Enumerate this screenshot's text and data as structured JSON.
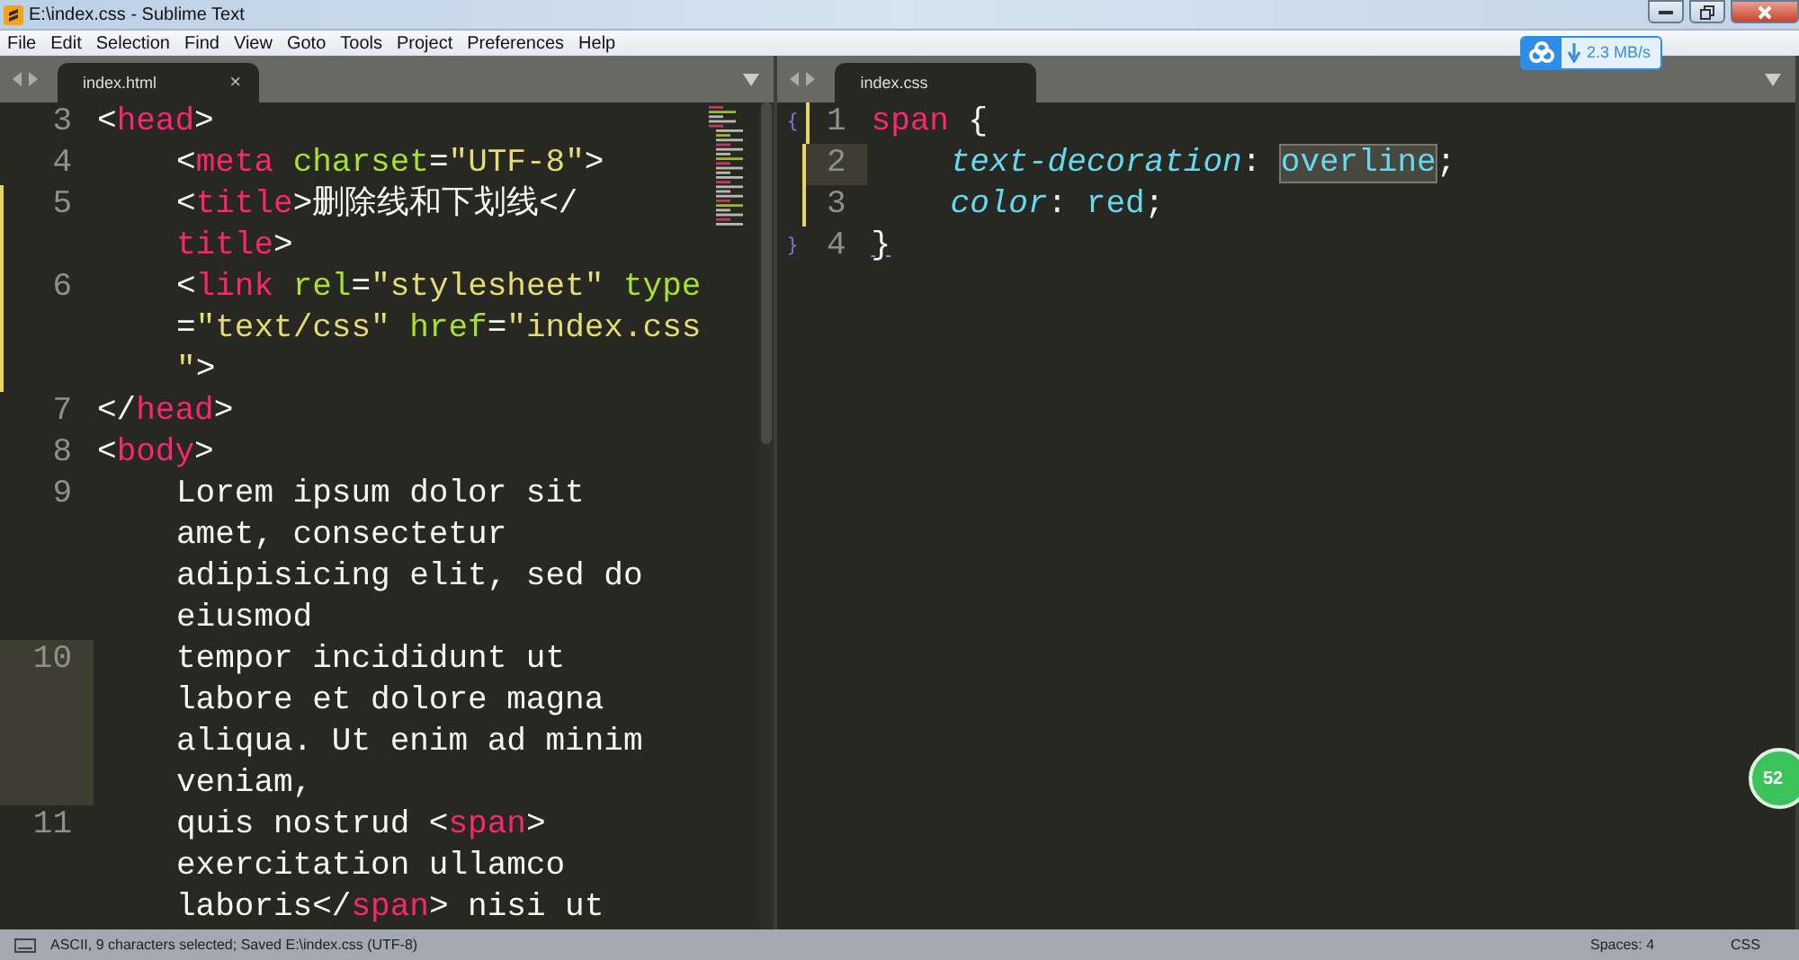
{
  "window": {
    "title": "E:\\index.css - Sublime Text"
  },
  "menu": [
    "File",
    "Edit",
    "Selection",
    "Find",
    "View",
    "Goto",
    "Tools",
    "Project",
    "Preferences",
    "Help"
  ],
  "download_widget": {
    "speed": "2.3 MB/s"
  },
  "badge": "52",
  "panes": [
    {
      "tab": {
        "label": "index.html",
        "close": "×"
      },
      "lines": [
        {
          "number": "3",
          "indent": false,
          "selected": false,
          "modified": false,
          "rows": [
            {
              "parts": [
                {
                  "kind": "punct",
                  "text": "<"
                },
                {
                  "kind": "tag",
                  "text": "head"
                },
                {
                  "kind": "punct",
                  "text": ">"
                }
              ]
            }
          ]
        },
        {
          "number": "4",
          "indent": true,
          "selected": false,
          "modified": false,
          "rows": [
            {
              "parts": [
                {
                  "kind": "punct",
                  "text": "<"
                },
                {
                  "kind": "tag",
                  "text": "meta"
                },
                {
                  "kind": "attr",
                  "text": " charset"
                },
                {
                  "kind": "punct",
                  "text": "="
                },
                {
                  "kind": "string",
                  "text": "\"UTF-8\""
                },
                {
                  "kind": "punct",
                  "text": ">"
                }
              ]
            }
          ]
        },
        {
          "number": "5",
          "indent": true,
          "selected": false,
          "modified": true,
          "rows": [
            {
              "parts": [
                {
                  "kind": "punct",
                  "text": "<"
                },
                {
                  "kind": "tag",
                  "text": "title"
                },
                {
                  "kind": "punct",
                  "text": ">删除线和下划线</"
                }
              ]
            },
            {
              "parts": [
                {
                  "kind": "tag",
                  "text": "title"
                },
                {
                  "kind": "punct",
                  "text": ">"
                }
              ]
            }
          ]
        },
        {
          "number": "6",
          "indent": true,
          "selected": false,
          "modified": true,
          "rows": [
            {
              "parts": [
                {
                  "kind": "punct",
                  "text": "<"
                },
                {
                  "kind": "tag",
                  "text": "link"
                },
                {
                  "kind": "attr",
                  "text": " rel"
                },
                {
                  "kind": "punct",
                  "text": "="
                },
                {
                  "kind": "string",
                  "text": "\"stylesheet\""
                },
                {
                  "kind": "attr",
                  "text": " type"
                }
              ]
            },
            {
              "parts": [
                {
                  "kind": "punct",
                  "text": "="
                },
                {
                  "kind": "string",
                  "text": "\"text/css\""
                },
                {
                  "kind": "attr",
                  "text": " href"
                },
                {
                  "kind": "punct",
                  "text": "="
                },
                {
                  "kind": "string",
                  "text": "\"index.css"
                }
              ]
            },
            {
              "parts": [
                {
                  "kind": "string",
                  "text": "\""
                },
                {
                  "kind": "punct",
                  "text": ">"
                }
              ]
            }
          ]
        },
        {
          "number": "7",
          "indent": false,
          "selected": false,
          "modified": false,
          "rows": [
            {
              "parts": [
                {
                  "kind": "punct",
                  "text": "</"
                },
                {
                  "kind": "tag",
                  "text": "head"
                },
                {
                  "kind": "punct",
                  "text": ">"
                }
              ]
            }
          ]
        },
        {
          "number": "8",
          "indent": false,
          "selected": false,
          "modified": false,
          "rows": [
            {
              "parts": [
                {
                  "kind": "punct",
                  "text": "<"
                },
                {
                  "kind": "tag",
                  "text": "body"
                },
                {
                  "kind": "punct",
                  "text": ">"
                }
              ]
            }
          ]
        },
        {
          "number": "9",
          "indent": true,
          "selected": false,
          "modified": false,
          "rows": [
            {
              "parts": [
                {
                  "kind": "punct",
                  "text": "Lorem ipsum dolor sit"
                }
              ]
            },
            {
              "parts": [
                {
                  "kind": "punct",
                  "text": "amet, consectetur"
                }
              ]
            },
            {
              "parts": [
                {
                  "kind": "punct",
                  "text": "adipisicing elit, sed do"
                }
              ]
            },
            {
              "parts": [
                {
                  "kind": "punct",
                  "text": "eiusmod"
                }
              ]
            }
          ]
        },
        {
          "number": "10",
          "indent": true,
          "selected": true,
          "modified": false,
          "rows": [
            {
              "parts": [
                {
                  "kind": "punct",
                  "text": "tempor incididunt ut"
                }
              ]
            },
            {
              "parts": [
                {
                  "kind": "punct",
                  "text": "labore et dolore magna"
                }
              ]
            },
            {
              "parts": [
                {
                  "kind": "punct",
                  "text": "aliqua. Ut enim ad minim"
                }
              ]
            },
            {
              "parts": [
                {
                  "kind": "punct",
                  "text": "veniam,"
                }
              ]
            }
          ]
        },
        {
          "number": "11",
          "indent": true,
          "selected": false,
          "modified": false,
          "rows": [
            {
              "parts": [
                {
                  "kind": "punct",
                  "text": "quis nostrud <"
                },
                {
                  "kind": "tag",
                  "text": "span"
                },
                {
                  "kind": "punct",
                  "text": ">"
                }
              ]
            },
            {
              "parts": [
                {
                  "kind": "punct",
                  "text": "exercitation ullamco"
                }
              ]
            },
            {
              "parts": [
                {
                  "kind": "punct",
                  "text": "laboris</"
                },
                {
                  "kind": "tag",
                  "text": "span"
                },
                {
                  "kind": "punct",
                  "text": "> nisi ut"
                }
              ]
            }
          ]
        }
      ]
    },
    {
      "tab": {
        "label": "index.css"
      },
      "lines": [
        {
          "number": "1",
          "fold": "{",
          "indent": false,
          "selected": false,
          "modified": true,
          "rows": [
            {
              "parts": [
                {
                  "kind": "tag",
                  "text": "span"
                },
                {
                  "kind": "punct",
                  "text": " {"
                }
              ]
            }
          ]
        },
        {
          "number": "2",
          "indent": true,
          "selected": true,
          "modified": true,
          "rows": [
            {
              "parts": [
                {
                  "kind": "property",
                  "text": "text-decoration"
                },
                {
                  "kind": "punct",
                  "text": ": "
                },
                {
                  "kind": "selection",
                  "text": "overline"
                },
                {
                  "kind": "punct",
                  "text": ";"
                }
              ]
            }
          ]
        },
        {
          "number": "3",
          "indent": true,
          "selected": false,
          "modified": true,
          "rows": [
            {
              "parts": [
                {
                  "kind": "property",
                  "text": "color"
                },
                {
                  "kind": "punct",
                  "text": ": "
                },
                {
                  "kind": "value",
                  "text": "red"
                },
                {
                  "kind": "punct",
                  "text": ";"
                }
              ]
            }
          ]
        },
        {
          "number": "4",
          "fold": "}",
          "indent": false,
          "selected": false,
          "modified": false,
          "rows": [
            {
              "parts": [
                {
                  "kind": "match",
                  "text": "}"
                }
              ]
            }
          ]
        }
      ]
    }
  ],
  "status_bar": {
    "message": "ASCII, 9 characters selected; Saved E:\\index.css (UTF-8)",
    "indentation": "Spaces: 4",
    "syntax": "CSS"
  }
}
